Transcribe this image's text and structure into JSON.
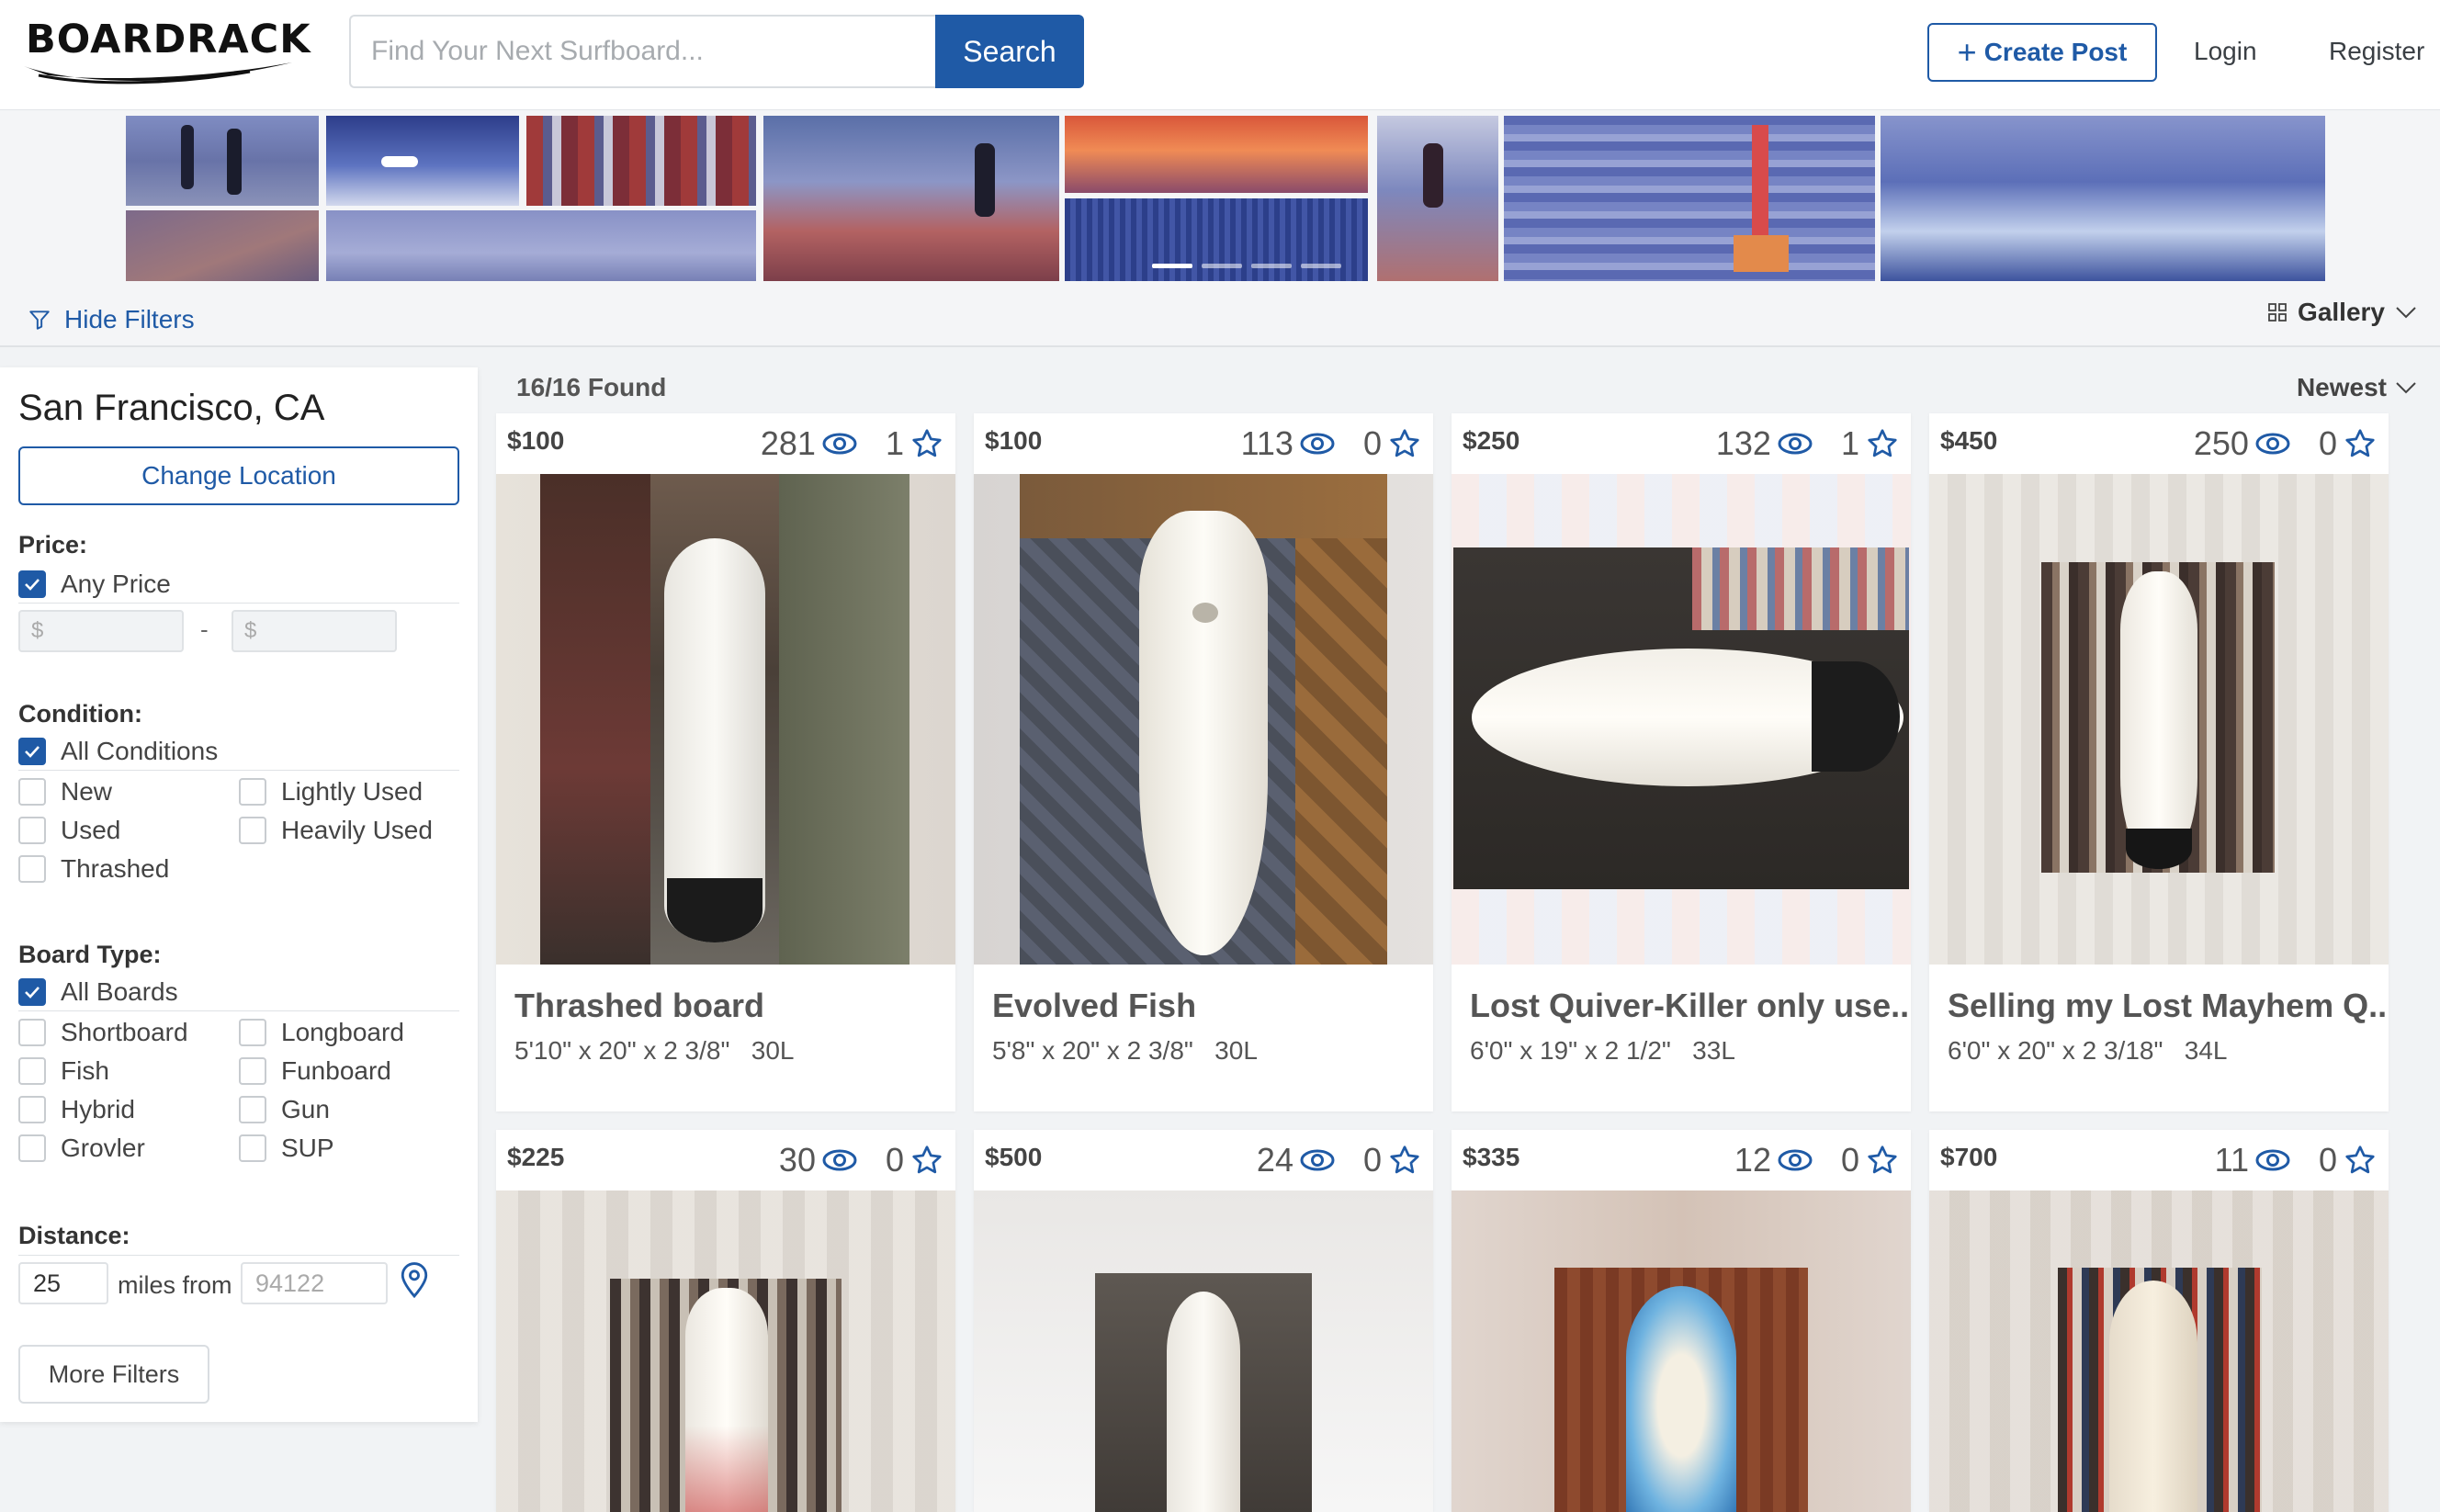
{
  "brand": {
    "name": "BOARDRACK"
  },
  "search": {
    "placeholder": "Find Your Next Surfboard...",
    "button": "Search"
  },
  "nav": {
    "create_post": "Create Post",
    "login": "Login",
    "register": "Register"
  },
  "filter_bar": {
    "hide_filters": "Hide Filters",
    "view": "Gallery"
  },
  "sidebar": {
    "location": "San Francisco, CA",
    "change_location": "Change Location",
    "price": {
      "label": "Price:",
      "any": "Any Price",
      "any_checked": true,
      "min_placeholder": "$",
      "max_placeholder": "$",
      "separator": "-"
    },
    "condition": {
      "label": "Condition:",
      "all": "All Conditions",
      "options": [
        "New",
        "Lightly Used",
        "Used",
        "Heavily Used",
        "Thrashed"
      ]
    },
    "board_type": {
      "label": "Board Type:",
      "all": "All Boards",
      "options": [
        "Shortboard",
        "Longboard",
        "Fish",
        "Funboard",
        "Hybrid",
        "Gun",
        "Grovler",
        "SUP"
      ]
    },
    "distance": {
      "label": "Distance:",
      "miles": "25",
      "miles_from": "miles from",
      "zip_placeholder": "94122"
    },
    "more_filters": "More Filters"
  },
  "results": {
    "found": "16/16 Found",
    "sort": "Newest",
    "listings": [
      {
        "price": "$100",
        "views": "281",
        "stars": "1",
        "title": "Thrashed board",
        "dims": "5'10\" x 20\" x 2 3/8\"   30L"
      },
      {
        "price": "$100",
        "views": "113",
        "stars": "0",
        "title": "Evolved Fish",
        "dims": "5'8\" x 20\" x 2 3/8\"   30L"
      },
      {
        "price": "$250",
        "views": "132",
        "stars": "1",
        "title": "Lost Quiver-Killer only use...",
        "dims": "6'0\" x 19\" x 2 1/2\"   33L"
      },
      {
        "price": "$450",
        "views": "250",
        "stars": "0",
        "title": "Selling my Lost Mayhem Q...",
        "dims": "6'0\" x 20\" x 2 3/18\"   34L"
      },
      {
        "price": "$225",
        "views": "30",
        "stars": "0",
        "title": "",
        "dims": ""
      },
      {
        "price": "$500",
        "views": "24",
        "stars": "0",
        "title": "",
        "dims": ""
      },
      {
        "price": "$335",
        "views": "12",
        "stars": "0",
        "title": "",
        "dims": ""
      },
      {
        "price": "$700",
        "views": "11",
        "stars": "0",
        "title": "",
        "dims": ""
      }
    ]
  },
  "colors": {
    "accent": "#1f5aa6",
    "background": "#f1f3f5",
    "card": "#ffffff"
  }
}
